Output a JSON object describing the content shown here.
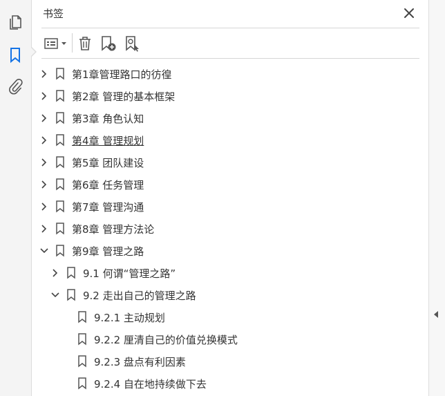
{
  "panel": {
    "title": "书签"
  },
  "tree": [
    {
      "label": "第1章管理路口的彷徨",
      "level": 0,
      "expander": "collapsed",
      "underline": false
    },
    {
      "label": "第2章 管理的基本框架",
      "level": 0,
      "expander": "collapsed",
      "underline": false
    },
    {
      "label": "第3章 角色认知",
      "level": 0,
      "expander": "collapsed",
      "underline": false
    },
    {
      "label": "第4章 管理规划",
      "level": 0,
      "expander": "collapsed",
      "underline": true
    },
    {
      "label": "第5章 团队建设",
      "level": 0,
      "expander": "collapsed",
      "underline": false
    },
    {
      "label": "第6章 任务管理",
      "level": 0,
      "expander": "collapsed",
      "underline": false
    },
    {
      "label": "第7章 管理沟通",
      "level": 0,
      "expander": "collapsed",
      "underline": false
    },
    {
      "label": "第8章 管理方法论",
      "level": 0,
      "expander": "collapsed",
      "underline": false
    },
    {
      "label": "第9章 管理之路",
      "level": 0,
      "expander": "expanded",
      "underline": false
    },
    {
      "label": "9.1 何谓“管理之路”",
      "level": 1,
      "expander": "collapsed",
      "underline": false
    },
    {
      "label": "9.2 走出自己的管理之路",
      "level": 1,
      "expander": "expanded",
      "underline": false
    },
    {
      "label": "9.2.1 主动规划",
      "level": 2,
      "expander": "none",
      "underline": false
    },
    {
      "label": "9.2.2 厘清自己的价值兑换模式",
      "level": 2,
      "expander": "none",
      "underline": false
    },
    {
      "label": "9.2.3 盘点有利因素",
      "level": 2,
      "expander": "none",
      "underline": false
    },
    {
      "label": "9.2.4 自在地持续做下去",
      "level": 2,
      "expander": "none",
      "underline": false
    }
  ],
  "icons": {
    "rail": [
      "pages-icon",
      "bookmark-icon",
      "attachment-icon"
    ],
    "toolbar": [
      "options-icon",
      "dropdown-icon",
      "trash-icon",
      "new-bookmark-icon",
      "bookmark-search-icon"
    ]
  },
  "colors": {
    "accent": "#1473e6",
    "icon": "#555555",
    "text": "#333333"
  }
}
